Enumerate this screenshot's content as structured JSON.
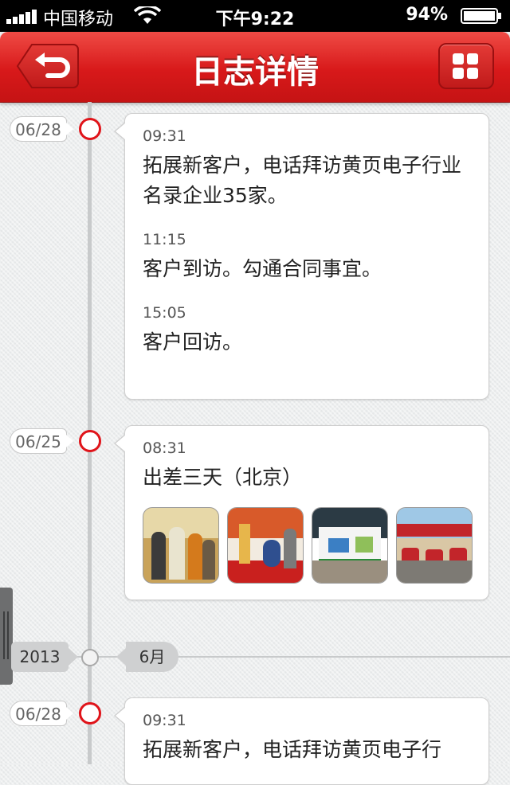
{
  "status_bar": {
    "carrier": "中国移动",
    "time": "下午9:22",
    "battery_percent": "94%",
    "signal_icon": "signal-bars-icon",
    "wifi_icon": "wifi-icon",
    "battery_icon": "battery-icon"
  },
  "navbar": {
    "title": "日志详情",
    "back_icon": "back-arrow-icon",
    "menu_icon": "grid-menu-icon"
  },
  "colors": {
    "accent": "#d8191a",
    "node_red": "#e0141a",
    "timeline_grey": "#c8cacb"
  },
  "timeline": {
    "year": "2013",
    "month": "6月",
    "groups": [
      {
        "date": "06/28",
        "entries": [
          {
            "time": "09:31",
            "text": "拓展新客户，电话拜访黄页电子行业名录企业35家。"
          },
          {
            "time": "11:15",
            "text": "客户到访。勾通合同事宜。"
          },
          {
            "time": "15:05",
            "text": "客户回访。"
          }
        ]
      },
      {
        "date": "06/25",
        "entries": [
          {
            "time": "08:31",
            "text": "出差三天（北京）"
          }
        ],
        "photos": [
          "photo-exhibition-people",
          "photo-exhibition-booth-red",
          "photo-exhibition-stand",
          "photo-exhibition-hall"
        ]
      },
      {
        "date": "06/28",
        "entries": [
          {
            "time": "09:31",
            "text": "拓展新客户，电话拜访黄页电子行"
          }
        ]
      }
    ]
  }
}
